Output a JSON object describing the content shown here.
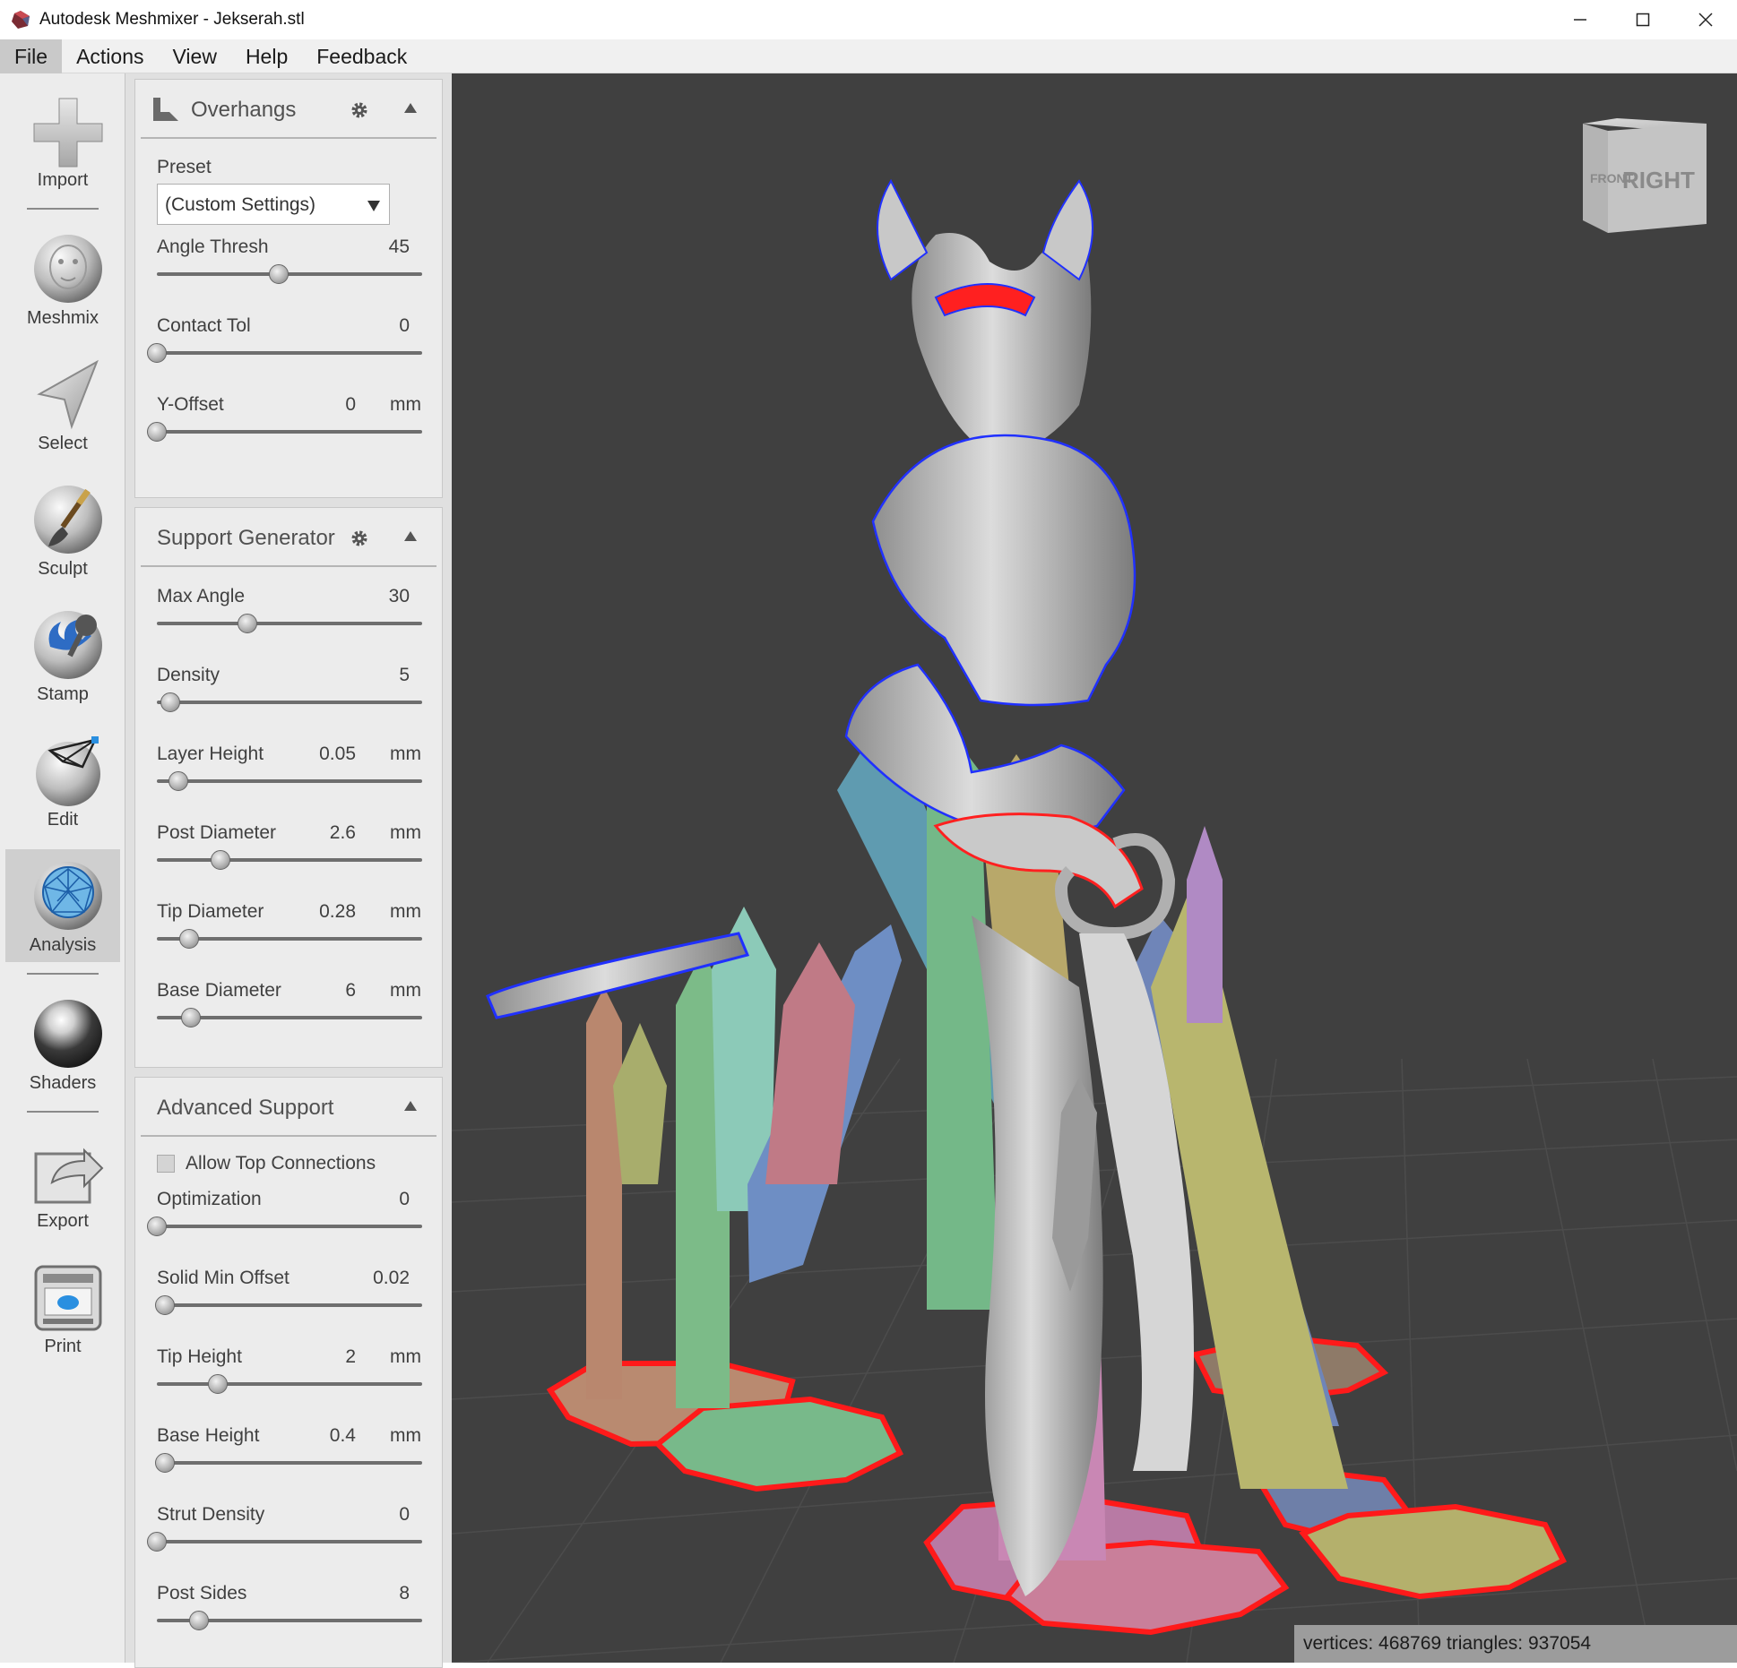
{
  "window": {
    "title": "Autodesk Meshmixer - Jekserah.stl"
  },
  "menu": [
    {
      "label": "File",
      "active": true
    },
    {
      "label": "Actions"
    },
    {
      "label": "View"
    },
    {
      "label": "Help"
    },
    {
      "label": "Feedback"
    }
  ],
  "toolbar": {
    "items": [
      {
        "label": "Import",
        "icon": "plus-icon"
      },
      {
        "label": "Meshmix",
        "icon": "face-sphere-icon"
      },
      {
        "label": "Select",
        "icon": "arrow-cursor-icon"
      },
      {
        "label": "Sculpt",
        "icon": "brush-icon"
      },
      {
        "label": "Stamp",
        "icon": "stamp-icon"
      },
      {
        "label": "Edit",
        "icon": "edit-mesh-icon"
      },
      {
        "label": "Analysis",
        "icon": "analysis-icon",
        "active": true
      },
      {
        "label": "Shaders",
        "icon": "shader-sphere-icon"
      },
      {
        "label": "Export",
        "icon": "export-icon"
      },
      {
        "label": "Print",
        "icon": "printer-icon"
      }
    ]
  },
  "overhangs": {
    "title": "Overhangs",
    "preset_label": "Preset",
    "preset_value": "(Custom Settings)",
    "angle_thresh": {
      "label": "Angle Thresh",
      "value": "45",
      "fraction": 0.46
    },
    "contact_tol": {
      "label": "Contact Tol",
      "value": "0",
      "fraction": 0.0
    },
    "y_offset": {
      "label": "Y-Offset",
      "value": "0",
      "unit": "mm",
      "fraction": 0.0
    }
  },
  "support_generator": {
    "title": "Support Generator",
    "max_angle": {
      "label": "Max Angle",
      "value": "30",
      "fraction": 0.34
    },
    "density": {
      "label": "Density",
      "value": "5",
      "fraction": 0.05
    },
    "layer_height": {
      "label": "Layer Height",
      "value": "0.05",
      "unit": "mm",
      "fraction": 0.08
    },
    "post_diameter": {
      "label": "Post Diameter",
      "value": "2.6",
      "unit": "mm",
      "fraction": 0.24
    },
    "tip_diameter": {
      "label": "Tip Diameter",
      "value": "0.28",
      "unit": "mm",
      "fraction": 0.12
    },
    "base_diameter": {
      "label": "Base Diameter",
      "value": "6",
      "unit": "mm",
      "fraction": 0.13
    }
  },
  "advanced_support": {
    "title": "Advanced Support",
    "allow_top": {
      "label": "Allow Top Connections",
      "checked": false
    },
    "optimization": {
      "label": "Optimization",
      "value": "0",
      "fraction": 0.0
    },
    "solid_min_offset": {
      "label": "Solid Min Offset",
      "value": "0.02",
      "fraction": 0.03
    },
    "tip_height": {
      "label": "Tip Height",
      "value": "2",
      "unit": "mm",
      "fraction": 0.23
    },
    "base_height": {
      "label": "Base Height",
      "value": "0.4",
      "unit": "mm",
      "fraction": 0.03
    },
    "strut_density": {
      "label": "Strut Density",
      "value": "0",
      "fraction": 0.0
    },
    "post_sides": {
      "label": "Post Sides",
      "value": "8",
      "fraction": 0.16
    }
  },
  "viewcube": {
    "front": "FRONT",
    "right": "RIGHT"
  },
  "status": {
    "text": "vertices: 468769 triangles: 937054"
  }
}
